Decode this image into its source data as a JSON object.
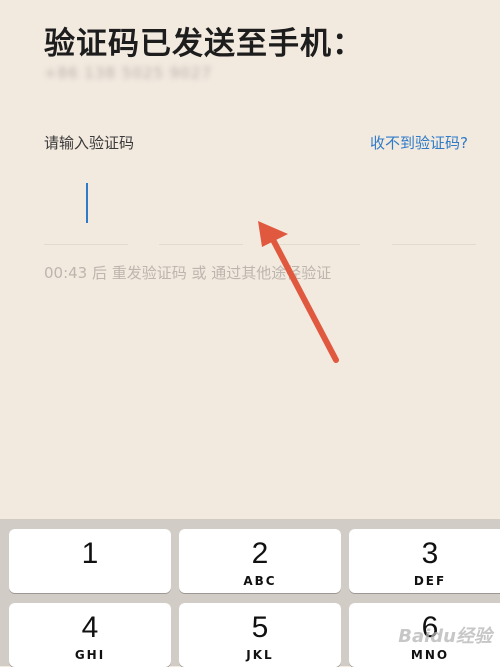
{
  "header": {
    "title": "验证码已发送至手机：",
    "phone": "+86 138 5025 9027"
  },
  "form": {
    "label": "请输入验证码",
    "help_link": "收不到验证码?",
    "resend_text": "00:43 后 重发验证码 或 通过其他途径验证"
  },
  "annotation": {
    "arrow_color": "#e0593e"
  },
  "keyboard": {
    "keys": [
      {
        "number": "1",
        "letters": ""
      },
      {
        "number": "2",
        "letters": "ABC"
      },
      {
        "number": "3",
        "letters": "DEF"
      },
      {
        "number": "4",
        "letters": "GHI"
      },
      {
        "number": "5",
        "letters": "JKL"
      },
      {
        "number": "6",
        "letters": "MNO"
      }
    ]
  },
  "watermark": {
    "text": "Baidu经验"
  }
}
